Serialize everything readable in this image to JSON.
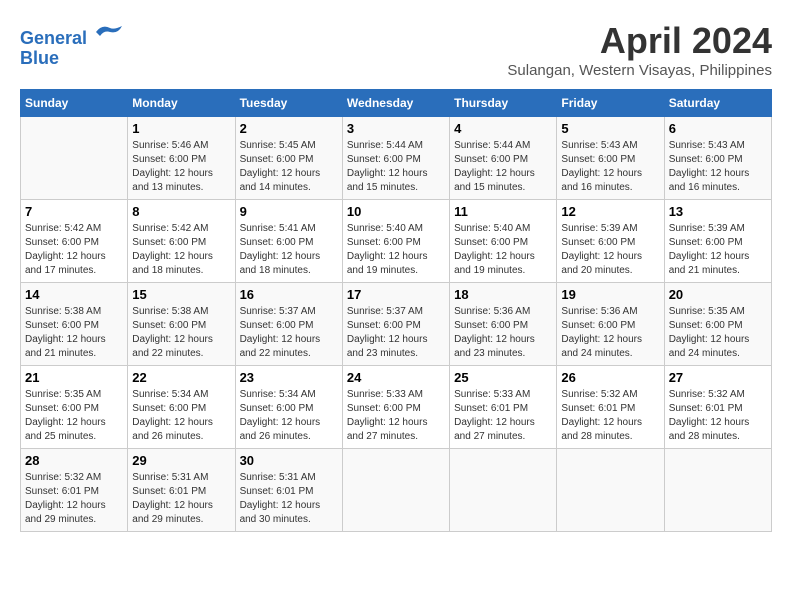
{
  "header": {
    "logo_line1": "General",
    "logo_line2": "Blue",
    "month_title": "April 2024",
    "location": "Sulangan, Western Visayas, Philippines"
  },
  "calendar": {
    "weekdays": [
      "Sunday",
      "Monday",
      "Tuesday",
      "Wednesday",
      "Thursday",
      "Friday",
      "Saturday"
    ],
    "weeks": [
      [
        {
          "day": "",
          "info": ""
        },
        {
          "day": "1",
          "info": "Sunrise: 5:46 AM\nSunset: 6:00 PM\nDaylight: 12 hours\nand 13 minutes."
        },
        {
          "day": "2",
          "info": "Sunrise: 5:45 AM\nSunset: 6:00 PM\nDaylight: 12 hours\nand 14 minutes."
        },
        {
          "day": "3",
          "info": "Sunrise: 5:44 AM\nSunset: 6:00 PM\nDaylight: 12 hours\nand 15 minutes."
        },
        {
          "day": "4",
          "info": "Sunrise: 5:44 AM\nSunset: 6:00 PM\nDaylight: 12 hours\nand 15 minutes."
        },
        {
          "day": "5",
          "info": "Sunrise: 5:43 AM\nSunset: 6:00 PM\nDaylight: 12 hours\nand 16 minutes."
        },
        {
          "day": "6",
          "info": "Sunrise: 5:43 AM\nSunset: 6:00 PM\nDaylight: 12 hours\nand 16 minutes."
        }
      ],
      [
        {
          "day": "7",
          "info": "Sunrise: 5:42 AM\nSunset: 6:00 PM\nDaylight: 12 hours\nand 17 minutes."
        },
        {
          "day": "8",
          "info": "Sunrise: 5:42 AM\nSunset: 6:00 PM\nDaylight: 12 hours\nand 18 minutes."
        },
        {
          "day": "9",
          "info": "Sunrise: 5:41 AM\nSunset: 6:00 PM\nDaylight: 12 hours\nand 18 minutes."
        },
        {
          "day": "10",
          "info": "Sunrise: 5:40 AM\nSunset: 6:00 PM\nDaylight: 12 hours\nand 19 minutes."
        },
        {
          "day": "11",
          "info": "Sunrise: 5:40 AM\nSunset: 6:00 PM\nDaylight: 12 hours\nand 19 minutes."
        },
        {
          "day": "12",
          "info": "Sunrise: 5:39 AM\nSunset: 6:00 PM\nDaylight: 12 hours\nand 20 minutes."
        },
        {
          "day": "13",
          "info": "Sunrise: 5:39 AM\nSunset: 6:00 PM\nDaylight: 12 hours\nand 21 minutes."
        }
      ],
      [
        {
          "day": "14",
          "info": "Sunrise: 5:38 AM\nSunset: 6:00 PM\nDaylight: 12 hours\nand 21 minutes."
        },
        {
          "day": "15",
          "info": "Sunrise: 5:38 AM\nSunset: 6:00 PM\nDaylight: 12 hours\nand 22 minutes."
        },
        {
          "day": "16",
          "info": "Sunrise: 5:37 AM\nSunset: 6:00 PM\nDaylight: 12 hours\nand 22 minutes."
        },
        {
          "day": "17",
          "info": "Sunrise: 5:37 AM\nSunset: 6:00 PM\nDaylight: 12 hours\nand 23 minutes."
        },
        {
          "day": "18",
          "info": "Sunrise: 5:36 AM\nSunset: 6:00 PM\nDaylight: 12 hours\nand 23 minutes."
        },
        {
          "day": "19",
          "info": "Sunrise: 5:36 AM\nSunset: 6:00 PM\nDaylight: 12 hours\nand 24 minutes."
        },
        {
          "day": "20",
          "info": "Sunrise: 5:35 AM\nSunset: 6:00 PM\nDaylight: 12 hours\nand 24 minutes."
        }
      ],
      [
        {
          "day": "21",
          "info": "Sunrise: 5:35 AM\nSunset: 6:00 PM\nDaylight: 12 hours\nand 25 minutes."
        },
        {
          "day": "22",
          "info": "Sunrise: 5:34 AM\nSunset: 6:00 PM\nDaylight: 12 hours\nand 26 minutes."
        },
        {
          "day": "23",
          "info": "Sunrise: 5:34 AM\nSunset: 6:00 PM\nDaylight: 12 hours\nand 26 minutes."
        },
        {
          "day": "24",
          "info": "Sunrise: 5:33 AM\nSunset: 6:00 PM\nDaylight: 12 hours\nand 27 minutes."
        },
        {
          "day": "25",
          "info": "Sunrise: 5:33 AM\nSunset: 6:01 PM\nDaylight: 12 hours\nand 27 minutes."
        },
        {
          "day": "26",
          "info": "Sunrise: 5:32 AM\nSunset: 6:01 PM\nDaylight: 12 hours\nand 28 minutes."
        },
        {
          "day": "27",
          "info": "Sunrise: 5:32 AM\nSunset: 6:01 PM\nDaylight: 12 hours\nand 28 minutes."
        }
      ],
      [
        {
          "day": "28",
          "info": "Sunrise: 5:32 AM\nSunset: 6:01 PM\nDaylight: 12 hours\nand 29 minutes."
        },
        {
          "day": "29",
          "info": "Sunrise: 5:31 AM\nSunset: 6:01 PM\nDaylight: 12 hours\nand 29 minutes."
        },
        {
          "day": "30",
          "info": "Sunrise: 5:31 AM\nSunset: 6:01 PM\nDaylight: 12 hours\nand 30 minutes."
        },
        {
          "day": "",
          "info": ""
        },
        {
          "day": "",
          "info": ""
        },
        {
          "day": "",
          "info": ""
        },
        {
          "day": "",
          "info": ""
        }
      ]
    ]
  }
}
